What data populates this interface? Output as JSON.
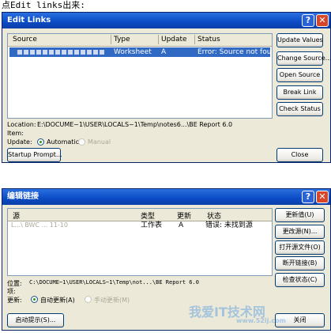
{
  "caption": "点Edit links出来:",
  "en": {
    "title": "Edit Links",
    "headers": [
      "Source",
      "Type",
      "Update",
      "Status"
    ],
    "row": {
      "type": "Worksheet",
      "update": "A",
      "status": "Error: Source not found"
    },
    "buttons": [
      "Update Values",
      "Change Source...",
      "Open Source",
      "Break Link",
      "Check Status"
    ],
    "location_label": "Location:",
    "location_value": "E:\\DOCUME~1\\USER\\LOCALS~1\\Temp\\notes6...\\BE Report 6.0",
    "item_label": "Item:",
    "update_label": "Update:",
    "auto": "Automatic",
    "manual": "Manual",
    "startup": "Startup Prompt...",
    "close": "Close"
  },
  "zh": {
    "title": "编辑链接",
    "headers": [
      "源",
      "类型",
      "更新",
      "状态"
    ],
    "row": {
      "source": "L...\\ BWC ...  11-10",
      "type": "工作表",
      "update": "A",
      "status": "错误: 未找到源"
    },
    "buttons": [
      "更新值(U)",
      "更改源(N)...",
      "打开源文件(O)",
      "断开链接(B)",
      "检查状态(C)"
    ],
    "location_label": "位置:",
    "location_value": "C:\\DOCUME~1\\USER\\LOCALS~1\\Temp\\not...\\BE Report 6.0",
    "item_label": "项:",
    "update_label": "更新:",
    "auto": "自动更新(A)",
    "manual": "手动更新(M)",
    "startup": "启动提示(S)...",
    "close": "关闭"
  },
  "watermark": {
    "text": "我爱IT技术网",
    "url": "www.52ij.com"
  }
}
